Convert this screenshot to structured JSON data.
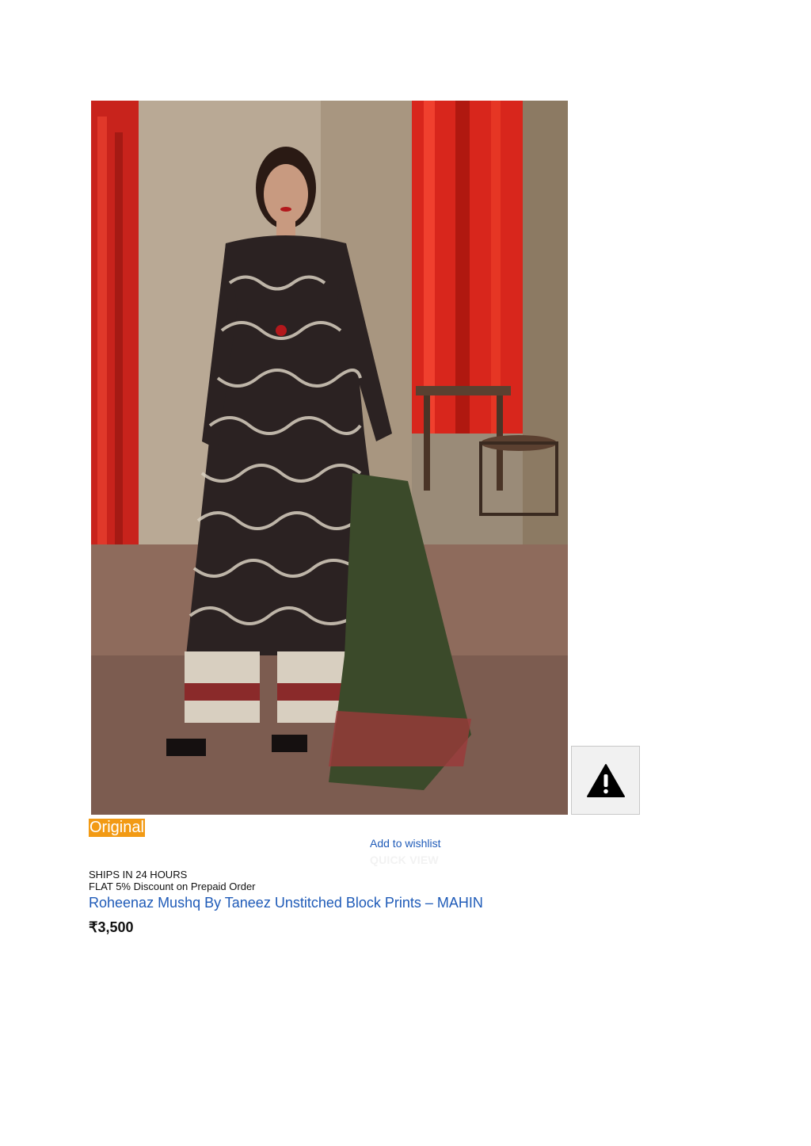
{
  "product": {
    "badge": "Original",
    "wishlist_label": "Add to wishlist",
    "quick_view_label": "QUICK VIEW",
    "ships_note": "SHIPS IN 24 HOURS",
    "discount_note": "FLAT 5% Discount on Prepaid Order",
    "title": "Roheenaz Mushq By Taneez Unstitched Block Prints – MAHIN",
    "price": "₹3,500"
  },
  "colors": {
    "badge_bg": "#f29a14",
    "link": "#1f5bb8"
  },
  "icons": {
    "broken_image": "warning-icon"
  }
}
